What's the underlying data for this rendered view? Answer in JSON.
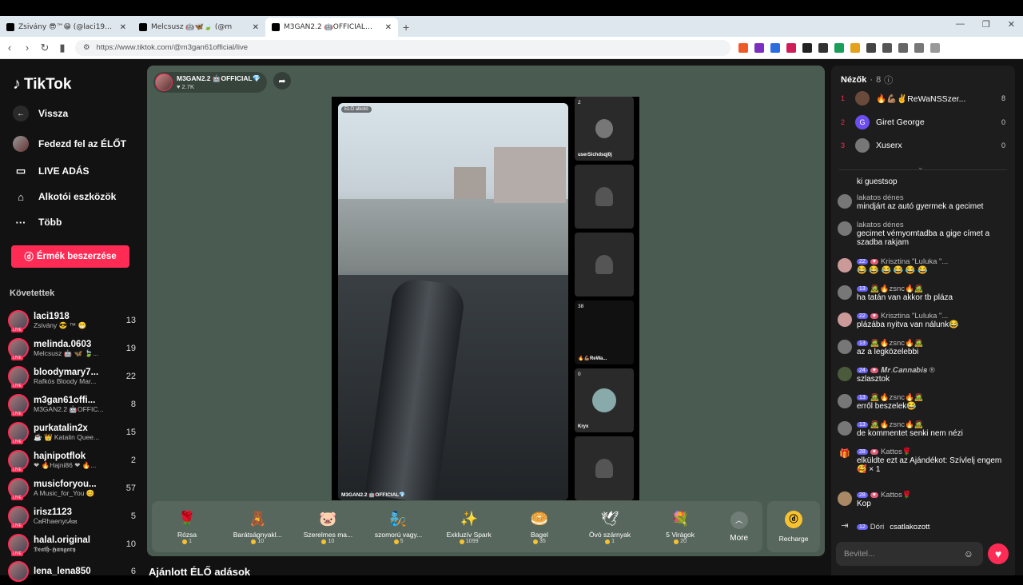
{
  "browser": {
    "tabs": [
      {
        "title": "Zsivány 😎™😁 (@laci1918) ÉLŐ",
        "active": false
      },
      {
        "title": "Melcsusz 🤖🦋🍃 (@m",
        "active": false
      },
      {
        "title": "M3GAN2.2 🤖OFFICIAL💎 (@",
        "active": true
      }
    ],
    "new_tab": "+",
    "url": "https://www.tiktok.com/@m3gan61official/live"
  },
  "sidebar": {
    "logo": "TikTok",
    "back": "Vissza",
    "explore": "Fedezd fel az ÉLŐT",
    "live": "LIVE ADÁS",
    "creator": "Alkotói eszközök",
    "more": "Több",
    "coins_btn": "Érmék beszerzése",
    "following_title": "Követettek",
    "following": [
      {
        "name": "laci1918",
        "sub": "Zsivány 😎 ™ 😁",
        "count": "13"
      },
      {
        "name": "melinda.0603",
        "sub": "Melcsusz 🤖 🦋 🍃...",
        "count": "19"
      },
      {
        "name": "bloodymary7...",
        "sub": "Rafkós Bloody Mar...",
        "count": "22"
      },
      {
        "name": "m3gan61offi...",
        "sub": "M3GAN2.2 🤖OFFIC...",
        "count": "8"
      },
      {
        "name": "purkatalin2x",
        "sub": "☕ 👑 Katalin Quee...",
        "count": "15"
      },
      {
        "name": "hajnipotflok",
        "sub": "❤ 🔥Hajni86 ❤ 🔥...",
        "count": "2"
      },
      {
        "name": "musicforyou...",
        "sub": "A Music_for_You 😊",
        "count": "57"
      },
      {
        "name": "irisz1123",
        "sub": "ᏟꮋRhaenyrᏗꮪꮋ",
        "count": "5"
      },
      {
        "name": "halal.original",
        "sub": "𝕯𝖊𝖆𝖙𝖍-𝕳𝖚𝖓𝖌𝖆𝖗𝖞",
        "count": "10"
      },
      {
        "name": "lena_lena850",
        "sub": "",
        "count": "6"
      }
    ]
  },
  "stream": {
    "host_name": "M3GAN2.2 🤖OFFICIAL💎",
    "likes": "2.7K",
    "video_tag": "ÉLŐ alkotó",
    "video_footer": "M3GAN2.2 🤖OFFICIAL💎",
    "guests": [
      {
        "count": "2",
        "name": "userSichdsqj0j"
      },
      {
        "count": "",
        "name": ""
      },
      {
        "count": "",
        "name": ""
      },
      {
        "count": "38",
        "name": "🔥💪🏽ReWa..."
      },
      {
        "count": "0",
        "name": "Kryx"
      },
      {
        "count": "",
        "name": ""
      }
    ]
  },
  "gifts": [
    {
      "name": "Rózsa",
      "price": "1",
      "icon": "🌹"
    },
    {
      "name": "Barátságnyakl...",
      "price": "10",
      "icon": "🧸"
    },
    {
      "name": "Szerelmes ma...",
      "price": "10",
      "icon": "🐷"
    },
    {
      "name": "szomorú vagy...",
      "price": "5",
      "icon": "🧞"
    },
    {
      "name": "Exkluzív Spark",
      "price": "1099",
      "icon": "✨"
    },
    {
      "name": "Bagel",
      "price": "35",
      "icon": "🥯"
    },
    {
      "name": "Óvó szárnyak",
      "price": "1",
      "icon": "🕊"
    },
    {
      "name": "5 Virágok",
      "price": "20",
      "icon": "💐"
    }
  ],
  "gifts_more": "More",
  "recharge": "Recharge",
  "suggested_title": "Ajánlott ÉLŐ adások",
  "viewers": {
    "title": "Nézők",
    "count": "8",
    "list": [
      {
        "rank": "1",
        "name": "🔥💪🏽✌ReWaNSSzer...",
        "score": "8",
        "initial": ""
      },
      {
        "rank": "2",
        "name": "Giret George",
        "score": "0",
        "initial": "G"
      },
      {
        "rank": "3",
        "name": "Xuserx",
        "score": "0",
        "initial": ""
      }
    ]
  },
  "chat": [
    {
      "user": "",
      "lvl": "",
      "text": "ki guestsop"
    },
    {
      "user": "lakatos dénes",
      "lvl": "",
      "text": "mindjárt az autó gyermek a gecimet"
    },
    {
      "user": "lakatos dénes",
      "lvl": "",
      "text": "gecimet vémyomtadba a gige címet a szadba rakjam"
    },
    {
      "user": "Krisztina \"Luluka \"...",
      "lvl": "22",
      "text": "😂 😂 😂 😂 😂 😂"
    },
    {
      "user": "🧟🔥zsnc🔥🧟",
      "lvl": "13",
      "text": "ha tatán van akkor tb pláza"
    },
    {
      "user": "Krisztina \"Luluka \"...",
      "lvl": "22",
      "text": "plázába nyitva van nálunk😂"
    },
    {
      "user": "🧟🔥zsnc🔥🧟",
      "lvl": "13",
      "text": "az a legközelebbi"
    },
    {
      "user": "𝑴𝒓.𝑪𝒂𝒏𝒏𝒂𝒃𝒊𝒔 ®",
      "lvl": "24",
      "text": "szlasztok"
    },
    {
      "user": "🧟🔥zsnc🔥🧟",
      "lvl": "13",
      "text": "erről beszelek😂"
    },
    {
      "user": "🧟🔥zsnc🔥🧟",
      "lvl": "13",
      "text": "de kommentet senki nem nézi"
    },
    {
      "user": "Kattos🌹",
      "lvl": "28",
      "text": "elküldte ezt az Ajándékot: Szívlelj engem 🥰 × 1"
    },
    {
      "user": "Kattos🌹",
      "lvl": "28",
      "text": "Kop"
    },
    {
      "user": "Dóri",
      "lvl": "12",
      "text": "csatlakozott"
    }
  ],
  "input_placeholder": "Bevitel..."
}
